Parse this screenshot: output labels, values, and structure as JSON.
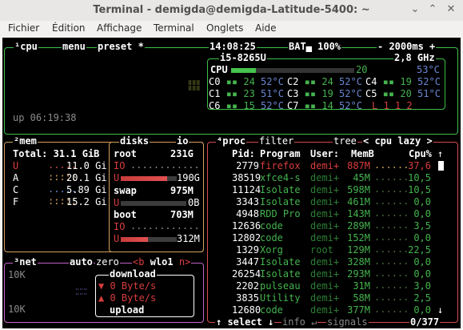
{
  "window": {
    "title": "Terminal - demigda@demigda-Latitude-5400: ~",
    "minimize": "⌄",
    "maximize": "⌃",
    "close": "✕"
  },
  "menu": [
    "Fichier",
    "Édition",
    "Affichage",
    "Terminal",
    "Onglets",
    "Aide"
  ],
  "cpu": {
    "title_num": "¹",
    "title": "cpu",
    "menu": "menu",
    "preset": "preset *",
    "clock": "14:08:25",
    "battery": "BAT▄ 100%",
    "refresh": "- 2000ms +",
    "model": "i5-8265U",
    "freq": "2,8 GHz",
    "total_label": "CPU",
    "total_pct": "20",
    "total_temp": "53°C",
    "total_pct_value": 20,
    "cores": [
      {
        "label": "C0",
        "pct": "24",
        "temp": "52°C"
      },
      {
        "label": "C1",
        "pct": "23",
        "temp": "51°C"
      },
      {
        "label": "C2",
        "pct": "24",
        "temp": "52°C"
      },
      {
        "label": "C3",
        "pct": "19",
        "temp": "52°C"
      },
      {
        "label": "C4",
        "pct": "19",
        "temp": "52°C"
      },
      {
        "label": "C5",
        "pct": "20",
        "temp": "51°C"
      },
      {
        "label": "C6",
        "pct": "15",
        "temp": "52°C"
      },
      {
        "label": "C7",
        "pct": "14",
        "temp": "52°C"
      }
    ],
    "load_avg": "L 1 1 2",
    "uptime": "up 06:19:38"
  },
  "mem": {
    "title_num": "²",
    "title": "mem",
    "total_label": "Total:",
    "total": "31.1 GiB",
    "rows": [
      {
        "label": "U",
        "value": "11.0 Gi"
      },
      {
        "label": "A",
        "value": "20.1 Gi"
      },
      {
        "label": "C",
        "value": "5.89 Gi"
      },
      {
        "label": "F",
        "value": "15.2 Gi"
      }
    ]
  },
  "disks": {
    "title": "disks",
    "io": "io",
    "entries": [
      {
        "name": "root",
        "size": "231G",
        "io_label": "IO",
        "used_label": "U",
        "used": "190G"
      },
      {
        "name": "swap",
        "size": "975M",
        "used_label": "U",
        "used": "0B"
      },
      {
        "name": "boot",
        "size": "703M",
        "io_label": "IO",
        "used_label": "U",
        "used": "312M"
      }
    ]
  },
  "net": {
    "title_num": "³",
    "title": "net",
    "auto": "auto",
    "zero": "zero",
    "iface": "<b wlo1 n>",
    "scale_top": "10K",
    "scale_bottom": "10K",
    "download_label": "download",
    "download_rate": "▼ 0 Byte/s",
    "upload_rate": "▲ 0 Byte/s",
    "upload_label": "upload"
  },
  "proc": {
    "title_num": "⁴",
    "title": "proc",
    "filter": "filter",
    "tree": "tree",
    "sort": "< cpu lazy >",
    "headers": {
      "pid": "Pid:",
      "program": "Program",
      "user": "User:",
      "mem": "MemB",
      "cpu": "Cpu%"
    },
    "rows": [
      {
        "pid": "2779",
        "program": "firefox",
        "user": "demi+",
        "mem": "887M",
        "cpu": "37,6",
        "highlight": true
      },
      {
        "pid": "38519",
        "program": "xfce4-s",
        "user": "demi+",
        "mem": "45M",
        "cpu": "10,5"
      },
      {
        "pid": "11124",
        "program": "Isolate",
        "user": "demi+",
        "mem": "598M",
        "cpu": "10,5"
      },
      {
        "pid": "3343",
        "program": "Isolate",
        "user": "demi+",
        "mem": "461M",
        "cpu": "0,0"
      },
      {
        "pid": "4948",
        "program": "RDD Pro",
        "user": "demi+",
        "mem": "143M",
        "cpu": "0,0"
      },
      {
        "pid": "12636",
        "program": "code",
        "user": "demi+",
        "mem": "289M",
        "cpu": "3,5"
      },
      {
        "pid": "12802",
        "program": "code",
        "user": "demi+",
        "mem": "152M",
        "cpu": "0,0"
      },
      {
        "pid": "1329",
        "program": "Xorg",
        "user": "root",
        "mem": "129M",
        "cpu": "22,5"
      },
      {
        "pid": "3447",
        "program": "Isolate",
        "user": "demi+",
        "mem": "328M",
        "cpu": "0,0"
      },
      {
        "pid": "26254",
        "program": "Isolate",
        "user": "demi+",
        "mem": "293M",
        "cpu": "0,0"
      },
      {
        "pid": "2202",
        "program": "pulseau",
        "user": "demi+",
        "mem": "31M",
        "cpu": "3,0"
      },
      {
        "pid": "3835",
        "program": "Utility",
        "user": "demi+",
        "mem": "58M",
        "cpu": "2,5"
      },
      {
        "pid": "12680",
        "program": "code",
        "user": "demi+",
        "mem": "377M",
        "cpu": "0,0"
      }
    ],
    "footer": {
      "select": "↑ select ↓",
      "info": "info ↵",
      "signals": "signals",
      "count": "0/377"
    },
    "scroll_up": "↑",
    "scroll_down": "↓"
  },
  "colors": {
    "cpu_border": "#3cbf4a",
    "mem_border": "#d2a05a",
    "net_border": "#c462c4",
    "proc_border": "#d84a4a",
    "accent_red": "#d93c3c"
  }
}
